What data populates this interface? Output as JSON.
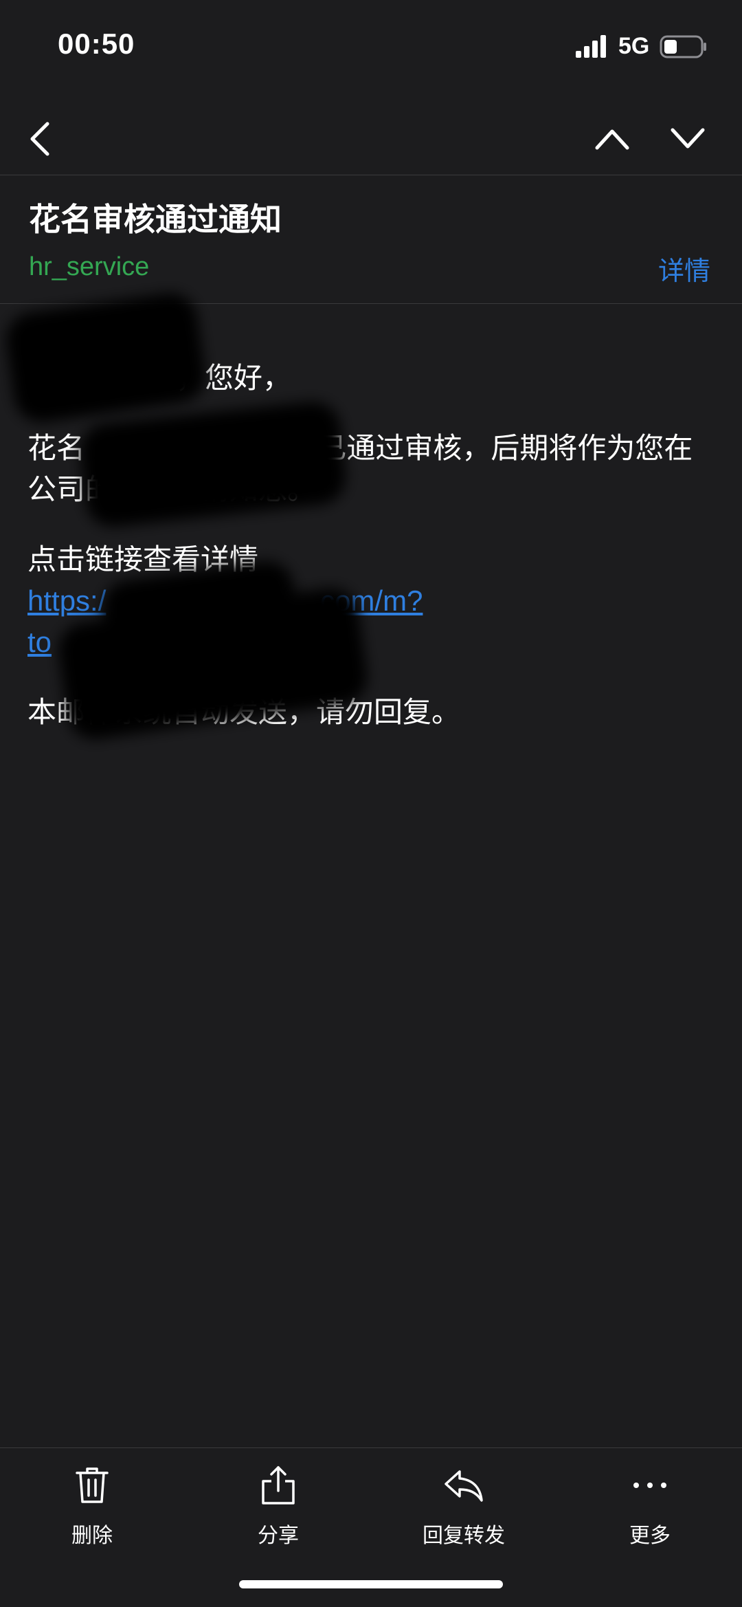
{
  "status_bar": {
    "time": "00:50",
    "network": "5G",
    "icons": [
      "signal-bars-icon",
      "battery-icon"
    ]
  },
  "nav": {
    "icons": [
      "chevron-left-icon",
      "chevron-up-icon",
      "chevron-down-icon"
    ]
  },
  "mail": {
    "subject": "花名审核通过通知",
    "sender": "hr_service",
    "details_label": "详情"
  },
  "body": {
    "greeting": "，您好，",
    "line1_prefix": "花名",
    "line1_suffix": "g”已通过审核，后期将作为您在公司的称呼，请知悉。",
    "line2": "点击链接查看详情",
    "link_line1_start": "https:/",
    "link_line1_end": ".com/m?",
    "link_line2": "to",
    "footer_note": "本邮件系统自动发送，请勿回复。"
  },
  "toolbar": {
    "items": [
      {
        "label": "删除",
        "icon": "trash-icon"
      },
      {
        "label": "分享",
        "icon": "share-icon"
      },
      {
        "label": "回复转发",
        "icon": "reply-icon"
      },
      {
        "label": "更多",
        "icon": "more-dots-icon"
      }
    ]
  },
  "colors": {
    "background": "#1c1c1e",
    "sender_green": "#34a853",
    "link_blue": "#2f7fe0",
    "divider": "#3a3a3c"
  }
}
